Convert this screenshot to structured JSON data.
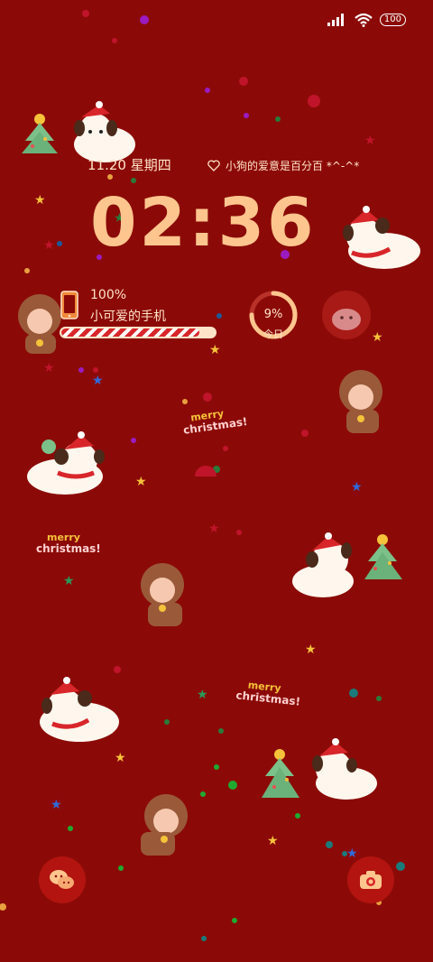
{
  "status_bar": {
    "battery_level": "100"
  },
  "lockscreen": {
    "date": "11.20 星期四",
    "quote": "小狗的爱意是百分百 *^-^*",
    "clock": "02:36"
  },
  "battery_widget": {
    "percent_text": "100%",
    "device_name": "小可爱的手机",
    "level": 0.9
  },
  "ring_widget": {
    "value_text": "9%",
    "label": "今日",
    "fraction": 0.75
  },
  "decor": {
    "merry": "merry",
    "christmas": "christmas!"
  },
  "colors": {
    "background": "#8b0a07",
    "clock": "#ffc58e",
    "text": "#ffe3c8"
  },
  "icons": {
    "signal": "signal-icon",
    "wifi": "wifi-icon",
    "battery": "battery-icon",
    "heart": "heart-icon",
    "phone": "phone-icon",
    "wechat": "wechat-icon",
    "camera": "camera-icon"
  }
}
